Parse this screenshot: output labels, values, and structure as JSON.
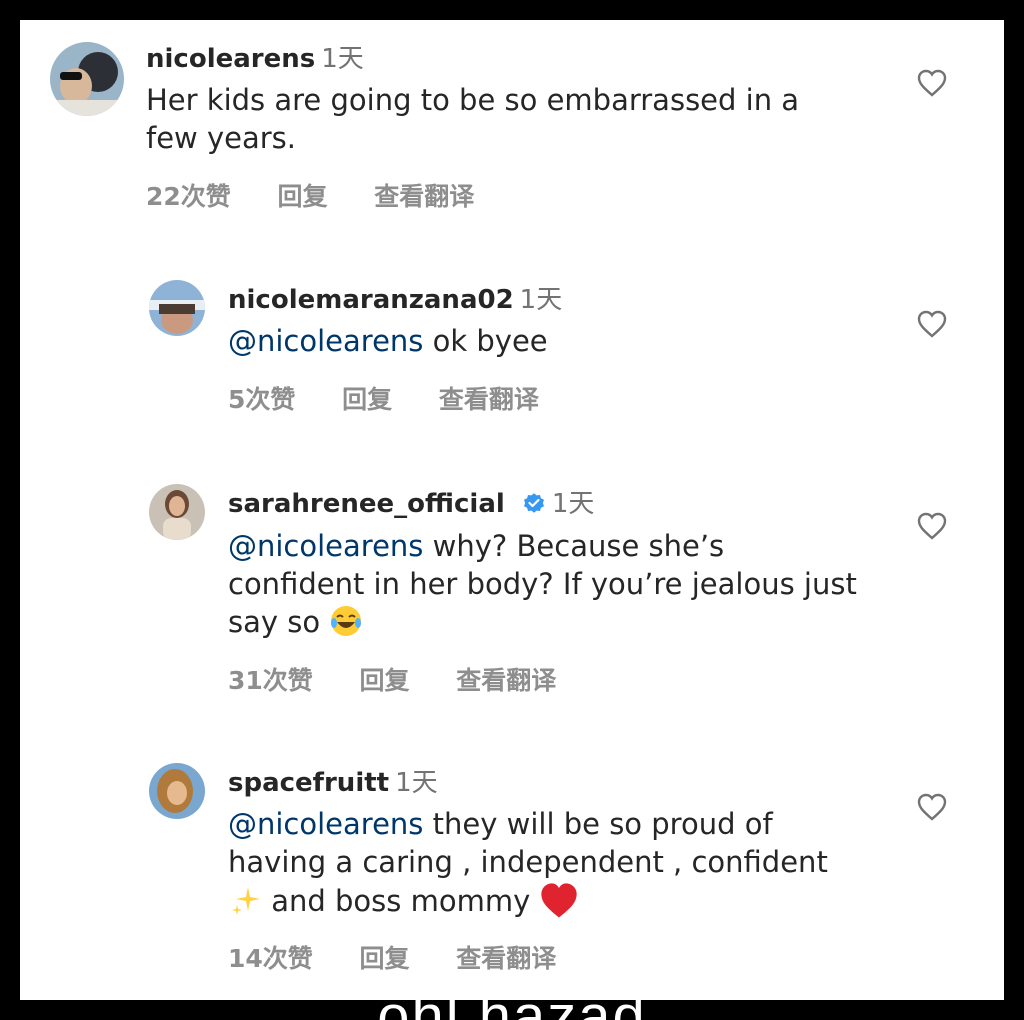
{
  "comments": [
    {
      "username": "nicolearens",
      "time": "1天",
      "verified": false,
      "mention": "",
      "text": "Her kids are going to be so embarrassed in a few years.",
      "likes": "22次赞",
      "reply": "回复",
      "translate": "查看翻译"
    },
    {
      "username": "nicolemaranzana02",
      "time": "1天",
      "verified": false,
      "mention": "@nicolearens",
      "text": " ok byee",
      "likes": "5次赞",
      "reply": "回复",
      "translate": "查看翻译"
    },
    {
      "username": "sarahrenee_official",
      "time": "1天",
      "verified": true,
      "mention": "@nicolearens",
      "text": " why? Because she’s confident in her body? If you’re jealous just say so",
      "emoji": "face-with-tears-of-joy-emoji",
      "likes": "31次赞",
      "reply": "回复",
      "translate": "查看翻译"
    },
    {
      "username": "spacefruitt",
      "time": "1天",
      "verified": false,
      "mention": "@nicolearens",
      "text_part1": " they will be so proud of having a caring , independent , confident",
      "text_part2": " and boss mommy ",
      "emoji1": "sparkles-emoji",
      "emoji2": "red-heart-emoji",
      "likes": "14次赞",
      "reply": "回复",
      "translate": "查看翻译"
    }
  ],
  "watermark": "ohl hazad",
  "colors": {
    "text": "#262626",
    "muted": "#8e8e8e",
    "mention": "#00376b",
    "verified": "#3897f0",
    "background": "#ffffff",
    "frame": "#000000"
  }
}
